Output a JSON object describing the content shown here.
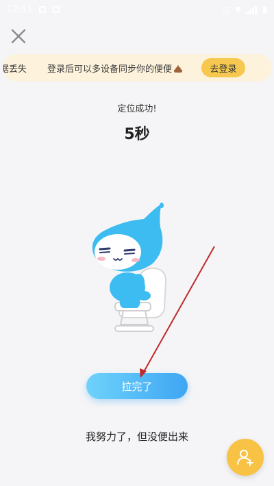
{
  "status_bar": {
    "time": "12:51",
    "battery_glyph": "▮"
  },
  "banner": {
    "lead_text": "据丢失",
    "message": "登录后可以多设备同步你的便便",
    "login_label": "去登录",
    "accent": "#f6c84f",
    "background": "#fdf3dc"
  },
  "status": {
    "located": "定位成功!"
  },
  "timer": {
    "value": "5秒"
  },
  "actions": {
    "done_label": "拉完了",
    "no_poop_label": "我努力了，但没便出来"
  },
  "icons": {
    "close": "close-icon",
    "mascot": "water-drop-mascot",
    "fab": "add-friend-icon"
  },
  "colors": {
    "primary_blue": "#3ea6f3",
    "fab_yellow": "#f8c245",
    "annotation_red": "#c0282a"
  }
}
